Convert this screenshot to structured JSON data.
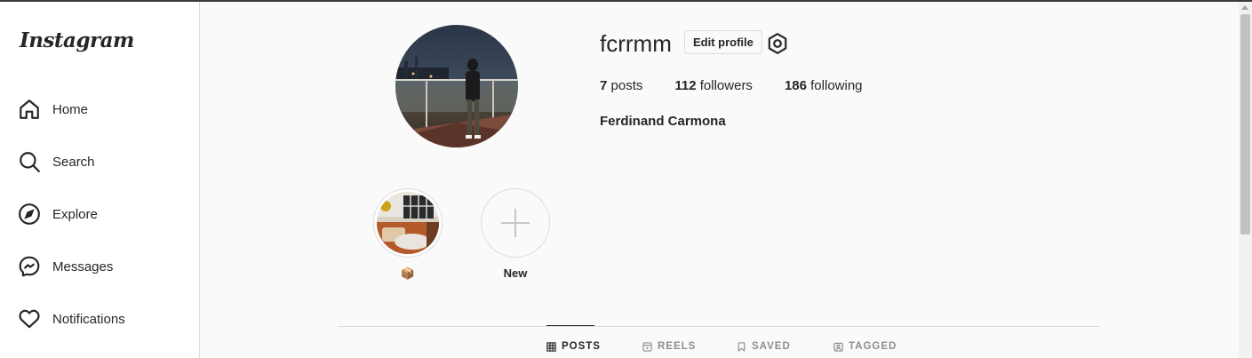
{
  "sidebar": {
    "logo": "Instagram",
    "items": [
      {
        "label": "Home",
        "icon": "home-icon"
      },
      {
        "label": "Search",
        "icon": "search-icon"
      },
      {
        "label": "Explore",
        "icon": "compass-icon"
      },
      {
        "label": "Messages",
        "icon": "messenger-icon"
      },
      {
        "label": "Notifications",
        "icon": "heart-icon"
      }
    ]
  },
  "profile": {
    "username": "fcrrmm",
    "edit_label": "Edit profile",
    "settings_icon": "gear-icon",
    "full_name": "Ferdinand Carmona",
    "stats": [
      {
        "count": "7",
        "label": "posts"
      },
      {
        "count": "112",
        "label": "followers"
      },
      {
        "count": "186",
        "label": "following"
      }
    ]
  },
  "highlights": [
    {
      "label": "📦"
    },
    {
      "label": "New",
      "icon": "plus-icon"
    }
  ],
  "tabs": [
    {
      "label": "POSTS",
      "icon": "grid-icon",
      "active": true
    },
    {
      "label": "REELS",
      "icon": "reels-icon",
      "active": false
    },
    {
      "label": "SAVED",
      "icon": "bookmark-icon",
      "active": false
    },
    {
      "label": "TAGGED",
      "icon": "tagged-icon",
      "active": false
    }
  ],
  "colors": {
    "text": "#262626",
    "muted": "#8e8e8e",
    "border": "#dbdbdb",
    "background": "#fafafa"
  }
}
